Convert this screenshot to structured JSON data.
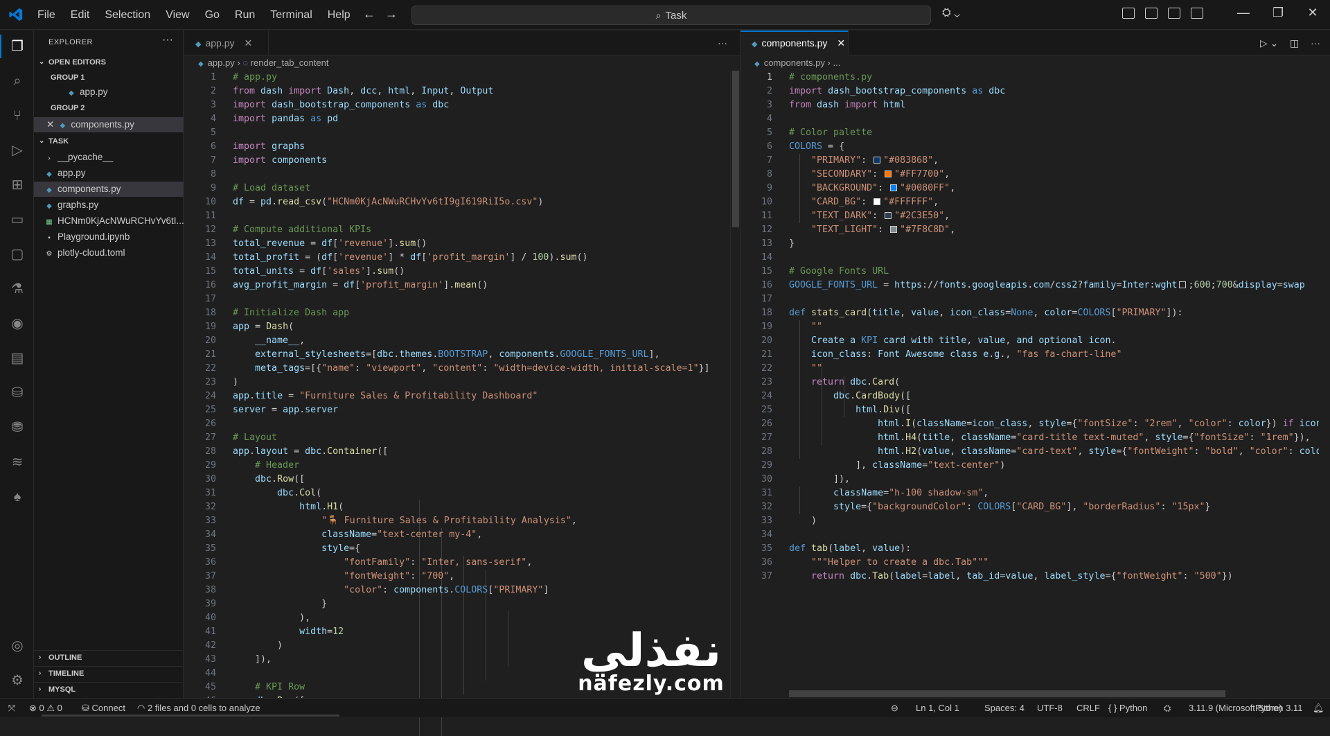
{
  "menu": [
    "File",
    "Edit",
    "Selection",
    "View",
    "Go",
    "Run",
    "Terminal",
    "Help"
  ],
  "search": {
    "label": "Task"
  },
  "explorer": {
    "title": "EXPLORER",
    "open_editors": "OPEN EDITORS",
    "group1": "GROUP 1",
    "group1_file": "app.py",
    "group2": "GROUP 2",
    "group2_file": "components.py",
    "task": "TASK",
    "files": [
      "__pycache__",
      "app.py",
      "components.py",
      "graphs.py",
      "HCNm0KjAcNWuRCHvYv6tI...",
      "Playground.ipynb",
      "plotly-cloud.toml"
    ],
    "outline": "OUTLINE",
    "timeline": "TIMELINE",
    "mysql": "MYSQL"
  },
  "left_editor": {
    "tab": "app.py",
    "breadcrumb_file": "app.py",
    "breadcrumb_symbol": "render_tab_content"
  },
  "right_editor": {
    "tab": "components.py",
    "breadcrumb_file": "components.py",
    "breadcrumb_symbol": "..."
  },
  "swatch_colors": {
    "primary": "#083868",
    "secondary": "#FF7700",
    "background": "#0080FF",
    "card_bg": "#FFFFFF",
    "text_dark": "#2C3E50",
    "text_light": "#7F8C8D"
  },
  "status": {
    "errors": "0",
    "warnings": "0",
    "connect": "Connect",
    "analyze": "2 files and 0 cells to analyze",
    "position": "Ln 1, Col 1",
    "spaces": "Spaces: 4",
    "encoding": "UTF-8",
    "eol": "CRLF",
    "language": "Python",
    "interpreter": "3.11.9 (Microsoft Store)",
    "python_version": "Python 3.11"
  },
  "watermark": {
    "arabic": "نفذلي",
    "latin": "nafezly.com"
  }
}
